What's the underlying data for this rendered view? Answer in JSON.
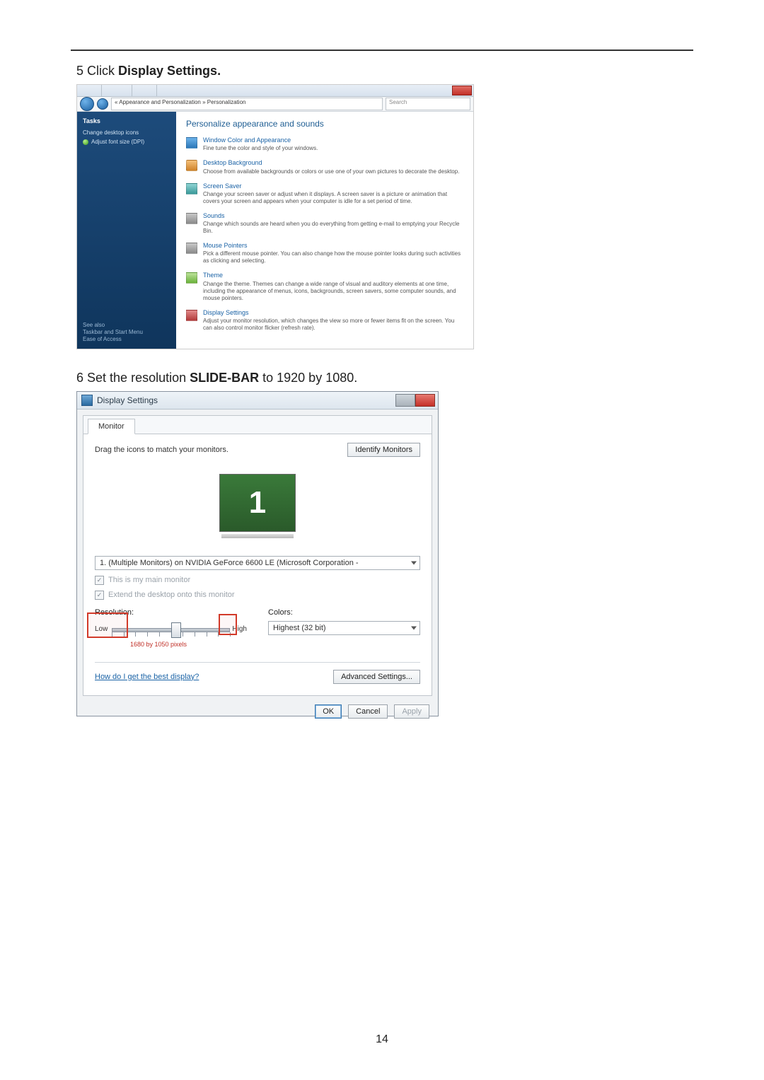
{
  "page_number": "14",
  "step5": {
    "num": "5",
    "pre": "Click ",
    "bold": "Display Settings."
  },
  "step6": {
    "num": "6",
    "pre": "Set the resolution ",
    "bold": "SLIDE-BAR",
    "post": " to 1920 by 1080."
  },
  "shot1": {
    "tabs": [
      "",
      "",
      ""
    ],
    "breadcrumb": "« Appearance and Personalization » Personalization",
    "search_placeholder": "Search",
    "sidebar": {
      "heading": "Tasks",
      "items": [
        "Change desktop icons",
        "Adjust font size (DPI)"
      ],
      "seealso_heading": "See also",
      "seealso": [
        "Taskbar and Start Menu",
        "Ease of Access"
      ]
    },
    "title": "Personalize appearance and sounds",
    "items": [
      {
        "title": "Window Color and Appearance",
        "desc": "Fine tune the color and style of your windows."
      },
      {
        "title": "Desktop Background",
        "desc": "Choose from available backgrounds or colors or use one of your own pictures to decorate the desktop."
      },
      {
        "title": "Screen Saver",
        "desc": "Change your screen saver or adjust when it displays. A screen saver is a picture or animation that covers your screen and appears when your computer is idle for a set period of time."
      },
      {
        "title": "Sounds",
        "desc": "Change which sounds are heard when you do everything from getting e-mail to emptying your Recycle Bin."
      },
      {
        "title": "Mouse Pointers",
        "desc": "Pick a different mouse pointer. You can also change how the mouse pointer looks during such activities as clicking and selecting."
      },
      {
        "title": "Theme",
        "desc": "Change the theme. Themes can change a wide range of visual and auditory elements at one time, including the appearance of menus, icons, backgrounds, screen savers, some computer sounds, and mouse pointers."
      },
      {
        "title": "Display Settings",
        "desc": "Adjust your monitor resolution, which changes the view so more or fewer items fit on the screen. You can also control monitor flicker (refresh rate)."
      }
    ]
  },
  "shot2": {
    "title": "Display Settings",
    "tab": "Monitor",
    "drag_label": "Drag the icons to match your monitors.",
    "identify_btn": "Identify Monitors",
    "monitor_num": "1",
    "dropdown": "1. (Multiple Monitors) on NVIDIA GeForce 6600 LE (Microsoft Corporation - ",
    "chk_main": "This is my main monitor",
    "chk_extend": "Extend the desktop onto this monitor",
    "res_label": "Resolution:",
    "low": "Low",
    "high": "High",
    "readout": "1680 by 1050 pixels",
    "colors_label": "Colors:",
    "colors_value": "Highest (32 bit)",
    "help": "How do I get the best display?",
    "adv_btn": "Advanced Settings...",
    "ok": "OK",
    "cancel": "Cancel",
    "apply": "Apply"
  }
}
